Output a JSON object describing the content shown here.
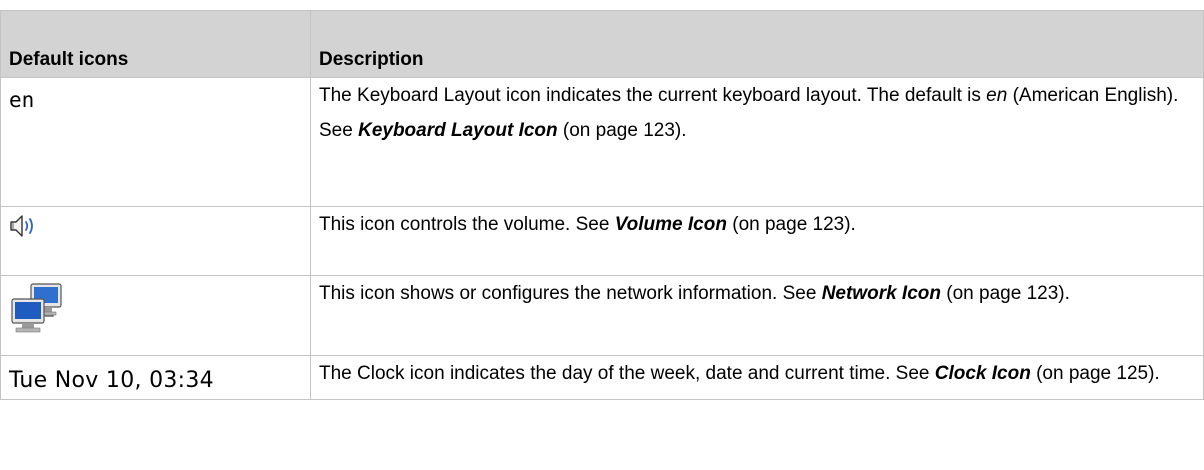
{
  "table": {
    "headers": [
      "Default icons",
      "Description"
    ],
    "rows": [
      {
        "icon_name": "keyboard-layout-icon",
        "icon_text": "en",
        "paragraphs": [
          {
            "parts": [
              {
                "text": "The Keyboard Layout icon indicates the current keyboard layout. The default is ",
                "style": "normal"
              },
              {
                "text": "en",
                "style": "italic"
              },
              {
                "text": " (American English).",
                "style": "normal"
              }
            ]
          },
          {
            "parts": [
              {
                "text": "See ",
                "style": "normal"
              },
              {
                "text": "Keyboard Layout Icon",
                "style": "ref"
              },
              {
                "text": " (on page 123).",
                "style": "normal"
              }
            ]
          }
        ]
      },
      {
        "icon_name": "volume-icon",
        "icon_text": "",
        "paragraphs": [
          {
            "parts": [
              {
                "text": "This icon controls the volume. See ",
                "style": "normal"
              },
              {
                "text": "Volume Icon",
                "style": "ref"
              },
              {
                "text": " (on page 123).",
                "style": "normal"
              }
            ]
          }
        ]
      },
      {
        "icon_name": "network-icon",
        "icon_text": "",
        "paragraphs": [
          {
            "parts": [
              {
                "text": "This icon shows or configures the network information. See ",
                "style": "normal"
              },
              {
                "text": "Network Icon",
                "style": "ref"
              },
              {
                "text": " (on page 123).",
                "style": "normal"
              }
            ]
          }
        ]
      },
      {
        "icon_name": "clock-icon",
        "icon_text": "Tue Nov 10, 03:34",
        "paragraphs": [
          {
            "parts": [
              {
                "text": "The Clock icon indicates the day of the week, date and current time. See ",
                "style": "normal"
              },
              {
                "text": "Clock Icon",
                "style": "ref"
              },
              {
                "text": " (on page 125).",
                "style": "normal"
              }
            ]
          }
        ]
      }
    ]
  }
}
